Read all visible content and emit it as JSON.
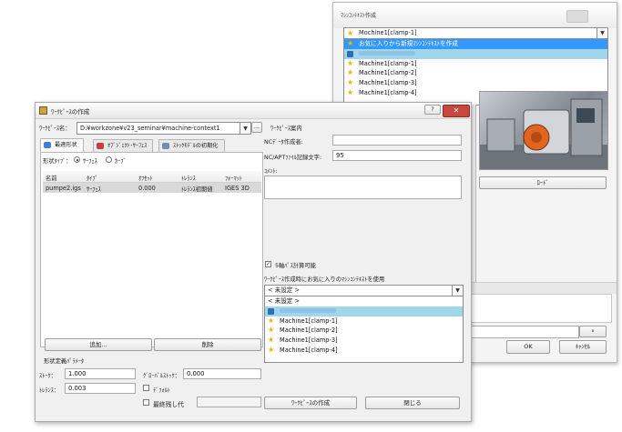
{
  "back_dialog": {
    "title": "ﾏｼﾝｺﾝﾃｷｽﾄ作成",
    "combo_value": "Mochine1[clamp-1]",
    "list": [
      {
        "label": "お気に入りから新規ﾏｼﾝｺﾝﾃｷｽﾄを作成",
        "icon": "star-icon",
        "state": "selected"
      },
      {
        "label": "",
        "icon": "document-icon",
        "state": "highlight"
      },
      {
        "label": "Machine1[clamp-1]",
        "icon": "star-icon",
        "state": ""
      },
      {
        "label": "Machine1[clamp-2]",
        "icon": "star-icon",
        "state": ""
      },
      {
        "label": "Machine1[clamp-3]",
        "icon": "star-icon",
        "state": ""
      },
      {
        "label": "Machine1[clamp-4]",
        "icon": "star-icon",
        "state": ""
      }
    ],
    "load_button": "ﾛｰﾄﾞ",
    "ok_button": "OK",
    "cancel_button": "ｷｬﾝｾﾙ"
  },
  "front_dialog": {
    "title": "ﾜｰｸﾋﾟｰｽの作成",
    "workpiece_name_label": "ﾜｰｸﾋﾟｰｽ名：",
    "workpiece_name_value": "D:¥workzone¥v23_seminar¥machine-context1",
    "browse_button": "...",
    "tabs": [
      {
        "label": "最適形状",
        "icon": "shape-icon",
        "active": true
      },
      {
        "label": "ｵﾌﾞｼﾞｪｸﾄ･ｻｰﾌｪｽ",
        "icon": "object-icon",
        "active": false
      },
      {
        "label": "ｽﾄｯｸﾓﾃﾞﾙの初期化",
        "icon": "stock-icon",
        "active": false
      }
    ],
    "shape_type_label": "形状ﾀｲﾌﾟ：",
    "shape_type_options": [
      "ｻｰﾌｪｽ",
      "ｶｰﾌﾞ"
    ],
    "table_headers": [
      "名前",
      "ﾀｲﾌﾟ",
      "ｵﾌｾｯﾄ",
      "ﾄﾚﾗﾝｽ",
      "ﾌｫｰﾏｯﾄ"
    ],
    "table_rows": [
      [
        "pumpe2.igs",
        "ｻｰﾌｪｽ",
        "0.000",
        "ﾄﾚﾗﾝｽ初期値",
        "IGES 3D"
      ]
    ],
    "add_button": "追加...",
    "delete_button": "削除",
    "shape_params_label": "形状定義ﾊﾟﾗﾒｰﾀ",
    "stock_label": "ｽﾄｰｸ：",
    "stock_value": "1.000",
    "global_stock_label": "ｸﾞﾛｰﾊﾞﾙｽﾄｯｸ：",
    "global_stock_value": "0.000",
    "tolerance_label": "ﾄﾚﾗﾝｽ：",
    "tolerance_value": "0.003",
    "default_label": "ﾃﾞﾌｫﾙﾄ",
    "min_remain_label": "最終残し代",
    "right_section_label": "ﾜｰｸﾋﾟｰｽ案内",
    "nc_author_label": "NCﾃﾞｰﾀ作成者:",
    "nc_apt_label": "NC/APTﾌｧｲﾙ記録文字:",
    "nc_apt_value": "95",
    "comment_label": "ｺﾒﾝﾄ:",
    "five_axis_label": "5軸ﾊﾟｽ計算可能",
    "five_axis_checked": true,
    "favorite_context_label": "ﾜｰｸﾋﾟｰｽ作成時にお気に入りのﾏｼﾝｺﾝﾃｷｽﾄを使用",
    "favorite_combo_value": "< 未設定 >",
    "favorite_list": [
      {
        "label": "< 未設定 >",
        "icon": "",
        "state": ""
      },
      {
        "label": "",
        "icon": "document-icon",
        "state": "highlight"
      },
      {
        "label": "Machine1[clamp-1]",
        "icon": "star-icon",
        "state": ""
      },
      {
        "label": "Machine1[clamp-2]",
        "icon": "star-icon",
        "state": ""
      },
      {
        "label": "Machine1[clamp-3]",
        "icon": "star-icon",
        "state": ""
      },
      {
        "label": "Machine1[clamp-4]",
        "icon": "star-icon",
        "state": ""
      }
    ],
    "create_button": "ﾜｰｸﾋﾟｰｽの作成",
    "close_button": "閉じる",
    "help_button": "?",
    "close_icon_button": "✕"
  }
}
